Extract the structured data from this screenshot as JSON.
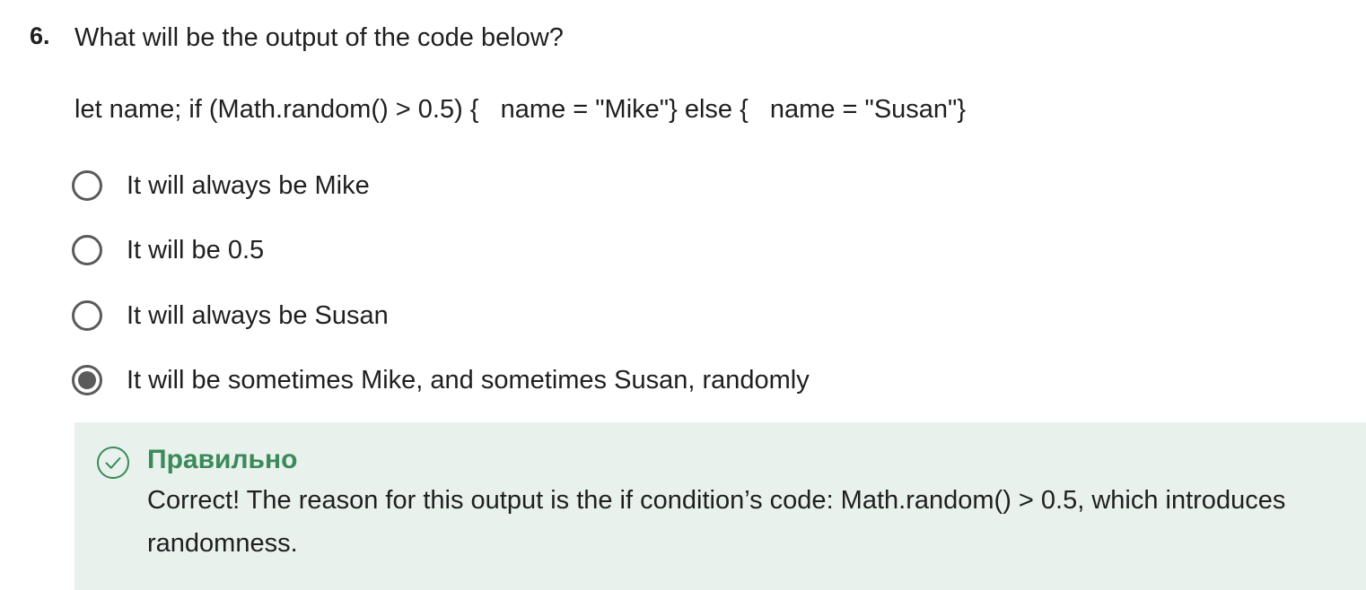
{
  "question": {
    "number": "6.",
    "prompt": "What will be the output of the code below?",
    "code": "let name; if (Math.random() > 0.5) {   name = \"Mike\"} else {   name = \"Susan\"}",
    "options": [
      {
        "label": "It will always be Mike",
        "selected": false
      },
      {
        "label": "It will be 0.5",
        "selected": false
      },
      {
        "label": "It will always be Susan",
        "selected": false
      },
      {
        "label": "It will be sometimes Mike, and sometimes Susan, randomly",
        "selected": true
      }
    ]
  },
  "feedback": {
    "icon": "check-circle-icon",
    "title": "Правильно",
    "text": "Correct! The reason for this output is the if condition’s code: Math.random() > 0.5, which introduces randomness.",
    "background_color": "#e8f1ec",
    "accent_color": "#3a8a5a"
  }
}
